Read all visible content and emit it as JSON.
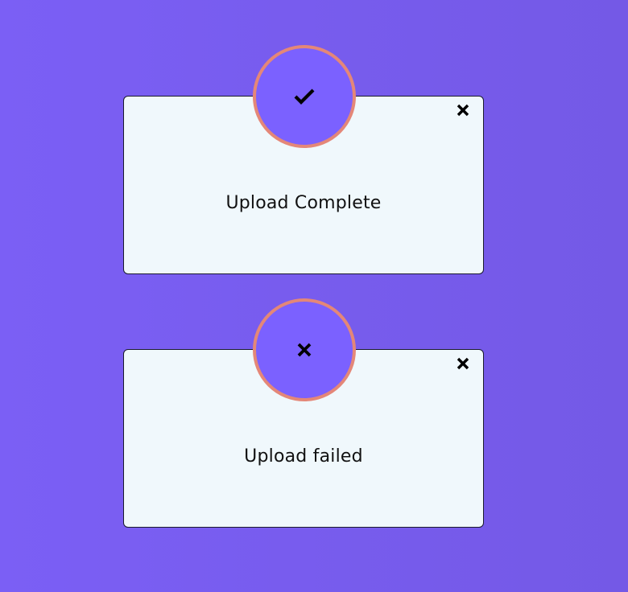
{
  "colors": {
    "background_start": "#7b5ff5",
    "background_end": "#7459e6",
    "card_background": "#f0f8fc",
    "badge_fill": "#7b61ff",
    "badge_ring": "#e48778",
    "icon": "#000000"
  },
  "notifications": [
    {
      "status": "success",
      "status_icon": "check-icon",
      "close_icon": "close-icon",
      "message": "Upload Complete"
    },
    {
      "status": "error",
      "status_icon": "cross-icon",
      "close_icon": "close-icon",
      "message": "Upload failed"
    }
  ]
}
